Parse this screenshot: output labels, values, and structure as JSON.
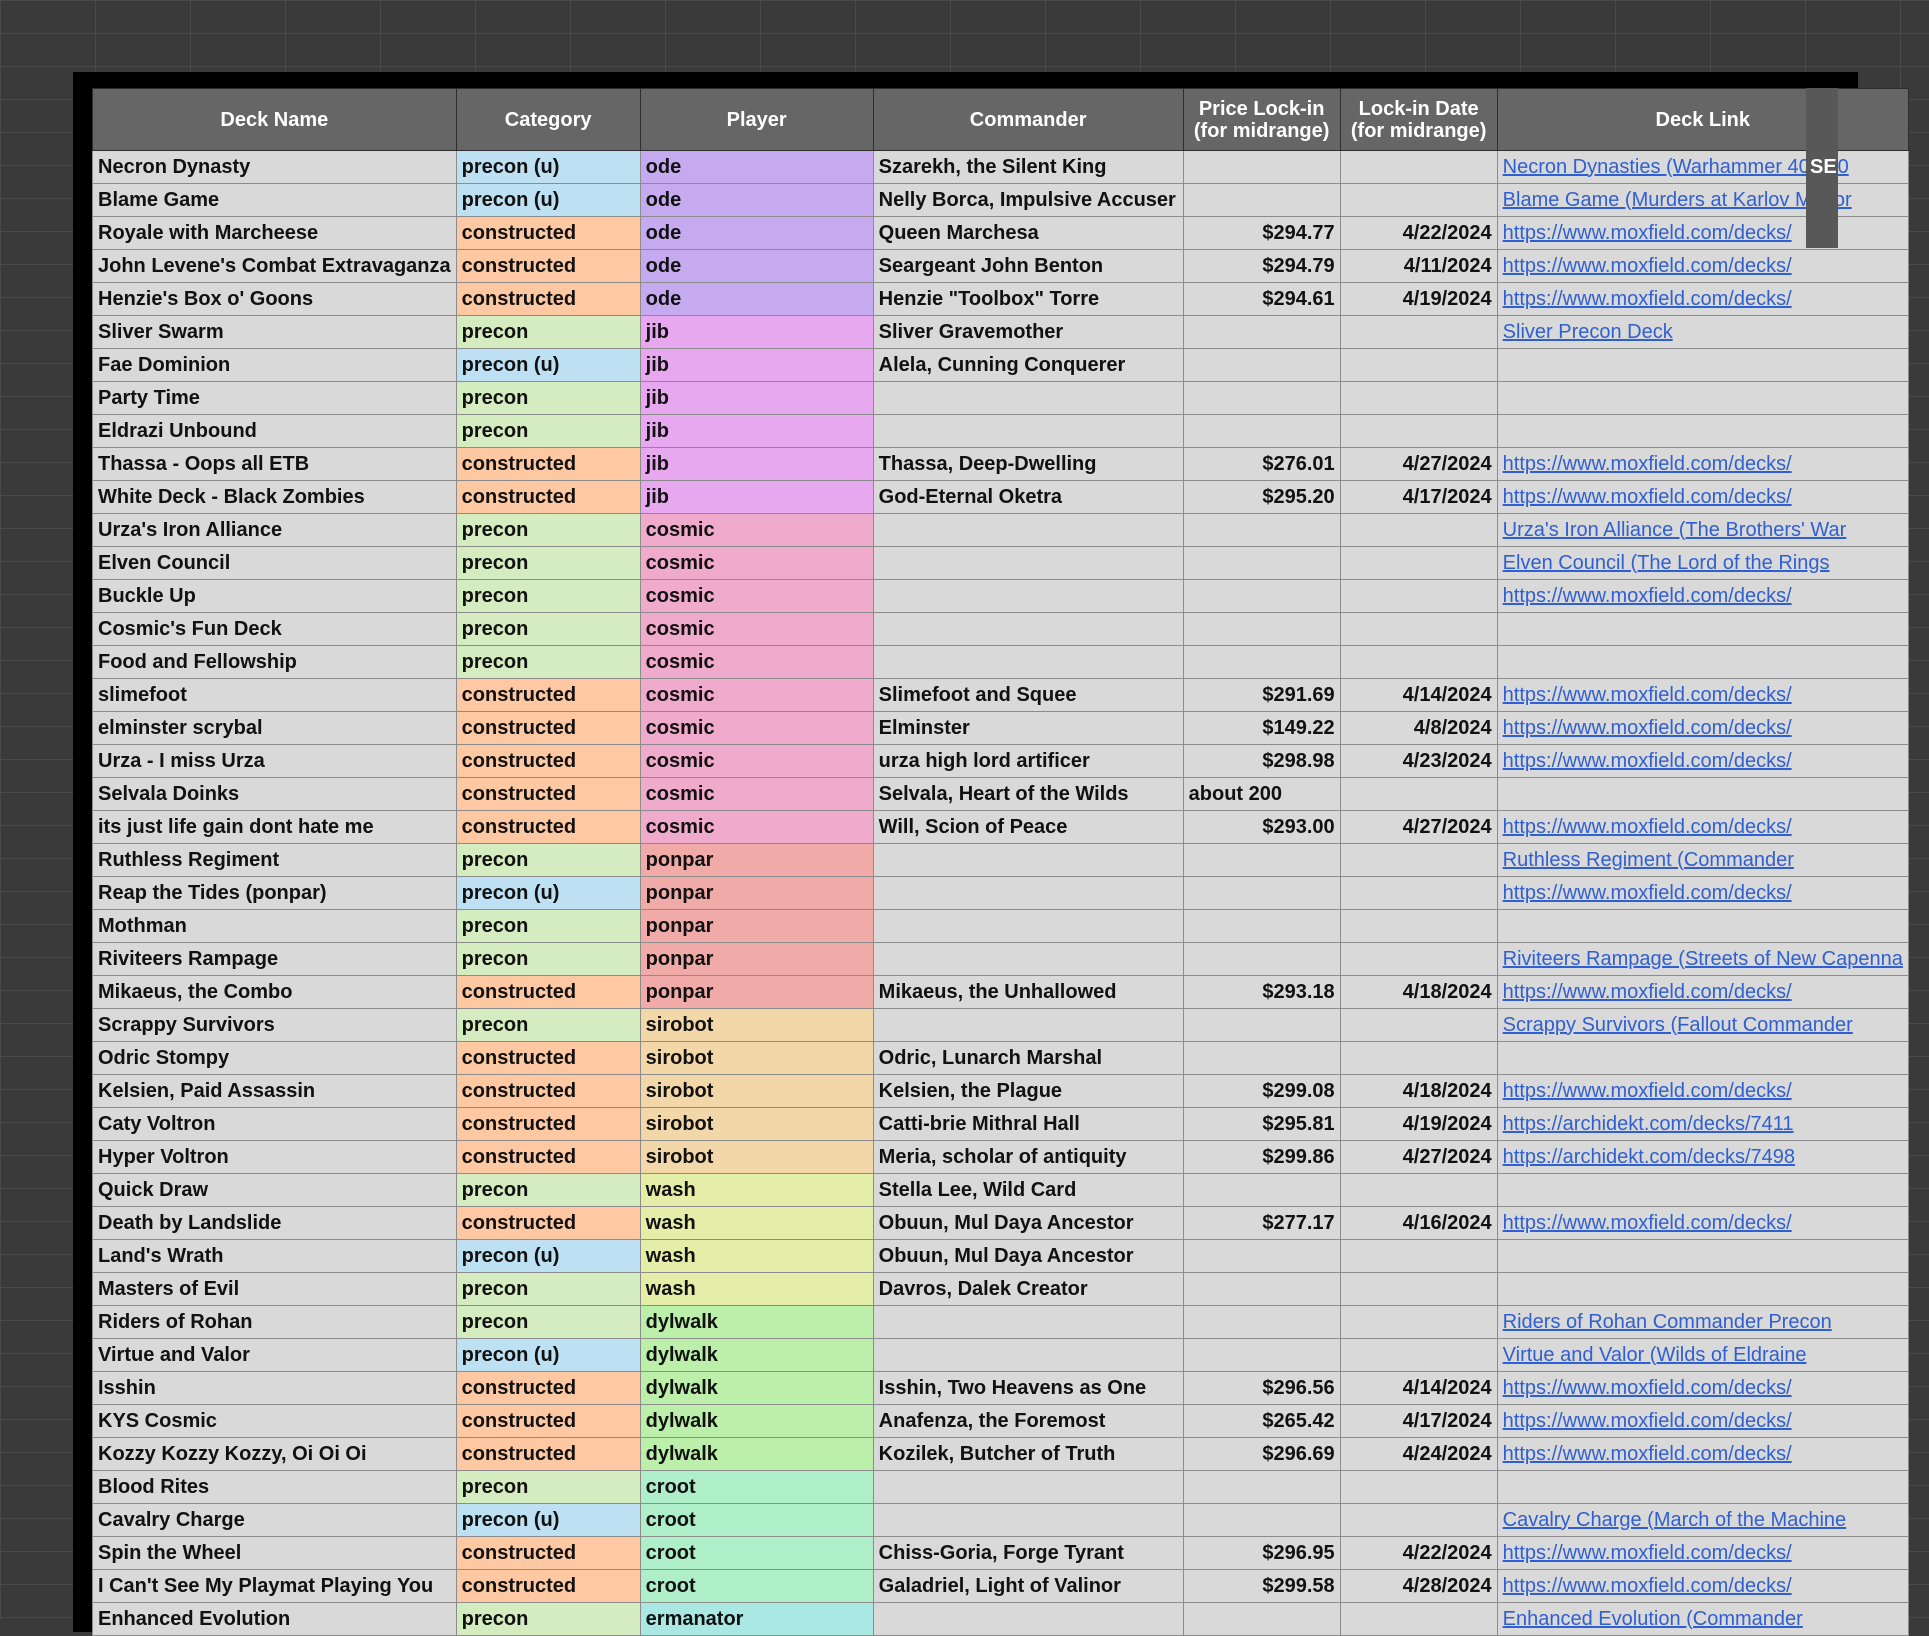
{
  "columns": [
    "Deck Name",
    "Category",
    "Player",
    "Commander",
    "Price Lock-in\n(for midrange)",
    "Lock-in Date\n(for midrange)",
    "Deck Link"
  ],
  "right_panel_label": "SE",
  "colors": {
    "precon_u": "#bde0f3",
    "precon": "#d4ecbf",
    "constructed": "#fec8a2",
    "ode": "#c6aaf0",
    "jib": "#e7a8ef",
    "cosmic": "#f0aacb",
    "ponpar": "#f0aaa8",
    "sirobot": "#f2d7a8",
    "wash": "#e4eea8",
    "dylwalk": "#bbefaa",
    "croot": "#aeeec9",
    "ermanator": "#aae8e4"
  },
  "rows": [
    {
      "name": "Necron Dynasty",
      "category": "precon (u)",
      "cat_key": "precon_u",
      "player": "ode",
      "commander": "Szarekh, the Silent King",
      "price": "",
      "date": "",
      "link": "Necron Dynasties (Warhammer 40,000"
    },
    {
      "name": "Blame Game",
      "category": "precon (u)",
      "cat_key": "precon_u",
      "player": "ode",
      "commander": "Nelly Borca, Impulsive Accuser",
      "price": "",
      "date": "",
      "link": "Blame Game (Murders at Karlov Manor"
    },
    {
      "name": "Royale with Marcheese",
      "category": "constructed",
      "cat_key": "constructed",
      "player": "ode",
      "commander": "Queen Marchesa",
      "price": "$294.77",
      "date": "4/22/2024",
      "link": "https://www.moxfield.com/decks/"
    },
    {
      "name": "John Levene's Combat Extravaganza",
      "category": "constructed",
      "cat_key": "constructed",
      "player": "ode",
      "commander": "Seargeant John Benton",
      "price": "$294.79",
      "date": "4/11/2024",
      "link": "https://www.moxfield.com/decks/"
    },
    {
      "name": "Henzie's Box o' Goons",
      "category": "constructed",
      "cat_key": "constructed",
      "player": "ode",
      "commander": "Henzie \"Toolbox\" Torre",
      "price": "$294.61",
      "date": "4/19/2024",
      "link": "https://www.moxfield.com/decks/"
    },
    {
      "name": "Sliver Swarm",
      "category": "precon",
      "cat_key": "precon",
      "player": "jib",
      "commander": "Sliver Gravemother",
      "price": "",
      "date": "",
      "link": "Sliver Precon Deck"
    },
    {
      "name": "Fae Dominion",
      "category": "precon (u)",
      "cat_key": "precon_u",
      "player": "jib",
      "commander": "Alela, Cunning Conquerer",
      "price": "",
      "date": "",
      "link": ""
    },
    {
      "name": "Party Time",
      "category": "precon",
      "cat_key": "precon",
      "player": "jib",
      "commander": "",
      "price": "",
      "date": "",
      "link": ""
    },
    {
      "name": "Eldrazi Unbound",
      "category": "precon",
      "cat_key": "precon",
      "player": "jib",
      "commander": "",
      "price": "",
      "date": "",
      "link": ""
    },
    {
      "name": "Thassa - Oops all ETB",
      "category": "constructed",
      "cat_key": "constructed",
      "player": "jib",
      "commander": "Thassa, Deep-Dwelling",
      "price": "$276.01",
      "date": "4/27/2024",
      "link": "https://www.moxfield.com/decks/"
    },
    {
      "name": "White Deck - Black Zombies",
      "category": "constructed",
      "cat_key": "constructed",
      "player": "jib",
      "commander": "God-Eternal Oketra",
      "price": "$295.20",
      "date": "4/17/2024",
      "link": "https://www.moxfield.com/decks/"
    },
    {
      "name": "Urza's Iron Alliance",
      "category": "precon",
      "cat_key": "precon",
      "player": "cosmic",
      "commander": "",
      "price": "",
      "date": "",
      "link": "Urza's Iron Alliance (The Brothers' War"
    },
    {
      "name": "Elven Council",
      "category": "precon",
      "cat_key": "precon",
      "player": "cosmic",
      "commander": "",
      "price": "",
      "date": "",
      "link": "Elven Council (The Lord of the Rings"
    },
    {
      "name": "Buckle Up",
      "category": "precon",
      "cat_key": "precon",
      "player": "cosmic",
      "commander": "",
      "price": "",
      "date": "",
      "link": "https://www.moxfield.com/decks/"
    },
    {
      "name": "Cosmic's Fun Deck",
      "category": "precon",
      "cat_key": "precon",
      "player": "cosmic",
      "commander": "",
      "price": "",
      "date": "",
      "link": ""
    },
    {
      "name": "Food and Fellowship",
      "category": "precon",
      "cat_key": "precon",
      "player": "cosmic",
      "commander": "",
      "price": "",
      "date": "",
      "link": ""
    },
    {
      "name": "slimefoot",
      "category": "constructed",
      "cat_key": "constructed",
      "player": "cosmic",
      "commander": "Slimefoot and Squee",
      "price": "$291.69",
      "date": "4/14/2024",
      "link": "https://www.moxfield.com/decks/"
    },
    {
      "name": "elminster scrybal",
      "category": "constructed",
      "cat_key": "constructed",
      "player": "cosmic",
      "commander": "Elminster",
      "price": "$149.22",
      "date": "4/8/2024",
      "link": "https://www.moxfield.com/decks/"
    },
    {
      "name": "Urza - I miss Urza",
      "category": "constructed",
      "cat_key": "constructed",
      "player": "cosmic",
      "commander": "urza high lord artificer",
      "price": "$298.98",
      "date": "4/23/2024",
      "link": "https://www.moxfield.com/decks/"
    },
    {
      "name": "Selvala Doinks",
      "category": "constructed",
      "cat_key": "constructed",
      "player": "cosmic",
      "commander": "Selvala, Heart of the Wilds",
      "price": "about 200",
      "price_align": "left",
      "date": "",
      "link": ""
    },
    {
      "name": "its just life gain dont hate me",
      "category": "constructed",
      "cat_key": "constructed",
      "player": "cosmic",
      "commander": "Will, Scion of Peace",
      "price": "$293.00",
      "date": "4/27/2024",
      "link": "https://www.moxfield.com/decks/"
    },
    {
      "name": "Ruthless Regiment",
      "category": "precon",
      "cat_key": "precon",
      "player": "ponpar",
      "commander": "",
      "price": "",
      "date": "",
      "link": "Ruthless Regiment (Commander"
    },
    {
      "name": "Reap the Tides (ponpar)",
      "category": "precon (u)",
      "cat_key": "precon_u",
      "player": "ponpar",
      "commander": "",
      "price": "",
      "date": "",
      "link": "https://www.moxfield.com/decks/"
    },
    {
      "name": "Mothman",
      "category": "precon",
      "cat_key": "precon",
      "player": "ponpar",
      "commander": "",
      "price": "",
      "date": "",
      "link": ""
    },
    {
      "name": "Riviteers Rampage",
      "category": "precon",
      "cat_key": "precon",
      "player": "ponpar",
      "commander": "",
      "price": "",
      "date": "",
      "link": "Riviteers Rampage (Streets of New Capenna"
    },
    {
      "name": "Mikaeus, the Combo",
      "category": "constructed",
      "cat_key": "constructed",
      "player": "ponpar",
      "commander": "Mikaeus, the Unhallowed",
      "price": "$293.18",
      "date": "4/18/2024",
      "link": "https://www.moxfield.com/decks/"
    },
    {
      "name": "Scrappy Survivors",
      "category": "precon",
      "cat_key": "precon",
      "player": "sirobot",
      "commander": "",
      "price": "",
      "date": "",
      "link": "Scrappy Survivors (Fallout Commander"
    },
    {
      "name": "Odric Stompy",
      "category": "constructed",
      "cat_key": "constructed",
      "player": "sirobot",
      "commander": "Odric, Lunarch Marshal",
      "price": "",
      "date": "",
      "link": ""
    },
    {
      "name": "Kelsien, Paid Assassin",
      "category": "constructed",
      "cat_key": "constructed",
      "player": "sirobot",
      "commander": "Kelsien, the Plague",
      "price": "$299.08",
      "date": "4/18/2024",
      "link": "https://www.moxfield.com/decks/"
    },
    {
      "name": "Caty Voltron",
      "category": "constructed",
      "cat_key": "constructed",
      "player": "sirobot",
      "commander": "Catti-brie Mithral Hall",
      "price": "$295.81",
      "date": "4/19/2024",
      "link": "https://archidekt.com/decks/7411"
    },
    {
      "name": "Hyper Voltron",
      "category": "constructed",
      "cat_key": "constructed",
      "player": "sirobot",
      "commander": "Meria, scholar of antiquity",
      "price": "$299.86",
      "date": "4/27/2024",
      "link": "https://archidekt.com/decks/7498"
    },
    {
      "name": "Quick Draw",
      "category": "precon",
      "cat_key": "precon",
      "player": "wash",
      "commander": "Stella Lee, Wild Card",
      "price": "",
      "date": "",
      "link": ""
    },
    {
      "name": "Death by Landslide",
      "category": "constructed",
      "cat_key": "constructed",
      "player": "wash",
      "commander": "Obuun, Mul Daya Ancestor",
      "price": "$277.17",
      "date": "4/16/2024",
      "link": "https://www.moxfield.com/decks/"
    },
    {
      "name": "Land's Wrath",
      "category": "precon (u)",
      "cat_key": "precon_u",
      "player": "wash",
      "commander": "Obuun, Mul Daya Ancestor",
      "price": "",
      "date": "",
      "link": ""
    },
    {
      "name": "Masters of Evil",
      "category": "precon",
      "cat_key": "precon",
      "player": "wash",
      "commander": "Davros, Dalek Creator",
      "price": "",
      "date": "",
      "link": ""
    },
    {
      "name": "Riders of Rohan",
      "category": "precon",
      "cat_key": "precon",
      "player": "dylwalk",
      "commander": "",
      "price": "",
      "date": "",
      "link": "Riders of Rohan Commander Precon"
    },
    {
      "name": "Virtue and Valor",
      "category": "precon (u)",
      "cat_key": "precon_u",
      "player": "dylwalk",
      "commander": "",
      "price": "",
      "date": "",
      "link": "Virtue and Valor (Wilds of Eldraine"
    },
    {
      "name": "Isshin",
      "category": "constructed",
      "cat_key": "constructed",
      "player": "dylwalk",
      "commander": "Isshin, Two Heavens as One",
      "price": "$296.56",
      "date": "4/14/2024",
      "link": "https://www.moxfield.com/decks/"
    },
    {
      "name": "KYS Cosmic",
      "category": "constructed",
      "cat_key": "constructed",
      "player": "dylwalk",
      "commander": "Anafenza, the Foremost",
      "price": "$265.42",
      "date": "4/17/2024",
      "link": "https://www.moxfield.com/decks/"
    },
    {
      "name": "Kozzy Kozzy Kozzy, Oi Oi Oi",
      "category": "constructed",
      "cat_key": "constructed",
      "player": "dylwalk",
      "commander": "Kozilek, Butcher of Truth",
      "price": "$296.69",
      "date": "4/24/2024",
      "link": "https://www.moxfield.com/decks/"
    },
    {
      "name": "Blood Rites",
      "category": "precon",
      "cat_key": "precon",
      "player": "croot",
      "commander": "",
      "price": "",
      "date": "",
      "link": ""
    },
    {
      "name": "Cavalry Charge",
      "category": "precon (u)",
      "cat_key": "precon_u",
      "player": "croot",
      "commander": "",
      "price": "",
      "date": "",
      "link": "Cavalry Charge (March of the Machine"
    },
    {
      "name": "Spin the Wheel",
      "category": "constructed",
      "cat_key": "constructed",
      "player": "croot",
      "commander": "Chiss-Goria, Forge Tyrant",
      "price": "$296.95",
      "date": "4/22/2024",
      "link": "https://www.moxfield.com/decks/"
    },
    {
      "name": "I Can't See My Playmat Playing You",
      "category": "constructed",
      "cat_key": "constructed",
      "player": "croot",
      "commander": "Galadriel, Light of Valinor",
      "price": "$299.58",
      "date": "4/28/2024",
      "link": "https://www.moxfield.com/decks/"
    },
    {
      "name": "Enhanced Evolution",
      "category": "precon",
      "cat_key": "precon",
      "player": "ermanator",
      "commander": "",
      "price": "",
      "date": "",
      "link": "Enhanced Evolution (Commander"
    }
  ]
}
